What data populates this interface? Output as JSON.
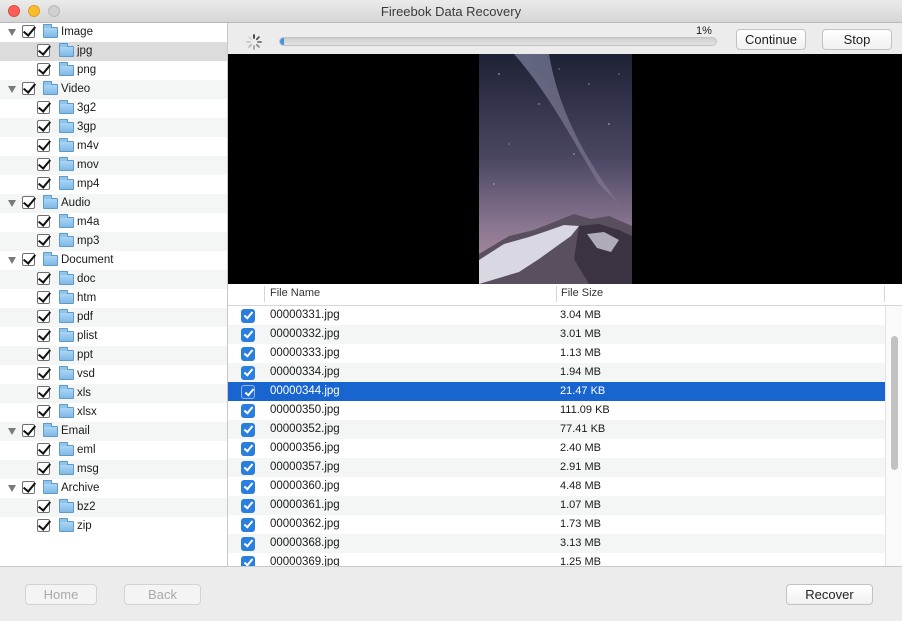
{
  "window": {
    "title": "Fireebok Data Recovery"
  },
  "progress": {
    "percent_label": "1%",
    "value": 0.01
  },
  "toolbar": {
    "continue_label": "Continue",
    "stop_label": "Stop"
  },
  "tree": {
    "image": {
      "label": "Image",
      "jpg": "jpg",
      "png": "png"
    },
    "video": {
      "label": "Video",
      "3g2": "3g2",
      "3gp": "3gp",
      "m4v": "m4v",
      "mov": "mov",
      "mp4": "mp4"
    },
    "audio": {
      "label": "Audio",
      "m4a": "m4a",
      "mp3": "mp3"
    },
    "document": {
      "label": "Document",
      "doc": "doc",
      "htm": "htm",
      "pdf": "pdf",
      "plist": "plist",
      "ppt": "ppt",
      "vsd": "vsd",
      "xls": "xls",
      "xlsx": "xlsx"
    },
    "email": {
      "label": "Email",
      "eml": "eml",
      "msg": "msg"
    },
    "archive": {
      "label": "Archive",
      "bz2": "bz2",
      "zip": "zip"
    }
  },
  "table": {
    "col_name": "File Name",
    "col_size": "File Size",
    "rows": [
      {
        "name": "00000331.jpg",
        "size": "3.04 MB"
      },
      {
        "name": "00000332.jpg",
        "size": "3.01 MB"
      },
      {
        "name": "00000333.jpg",
        "size": "1.13 MB"
      },
      {
        "name": "00000334.jpg",
        "size": "1.94 MB"
      },
      {
        "name": "00000344.jpg",
        "size": "21.47 KB"
      },
      {
        "name": "00000350.jpg",
        "size": "111.09 KB"
      },
      {
        "name": "00000352.jpg",
        "size": "77.41 KB"
      },
      {
        "name": "00000356.jpg",
        "size": "2.40 MB"
      },
      {
        "name": "00000357.jpg",
        "size": "2.91 MB"
      },
      {
        "name": "00000360.jpg",
        "size": "4.48 MB"
      },
      {
        "name": "00000361.jpg",
        "size": "1.07 MB"
      },
      {
        "name": "00000362.jpg",
        "size": "1.73 MB"
      },
      {
        "name": "00000368.jpg",
        "size": "3.13 MB"
      },
      {
        "name": "00000369.jpg",
        "size": "1.25 MB"
      }
    ]
  },
  "footer": {
    "home_label": "Home",
    "back_label": "Back",
    "recover_label": "Recover"
  },
  "colors": {
    "selection": "#1865d0",
    "checkbox": "#2a7fde",
    "progress": "#4a90e2"
  }
}
